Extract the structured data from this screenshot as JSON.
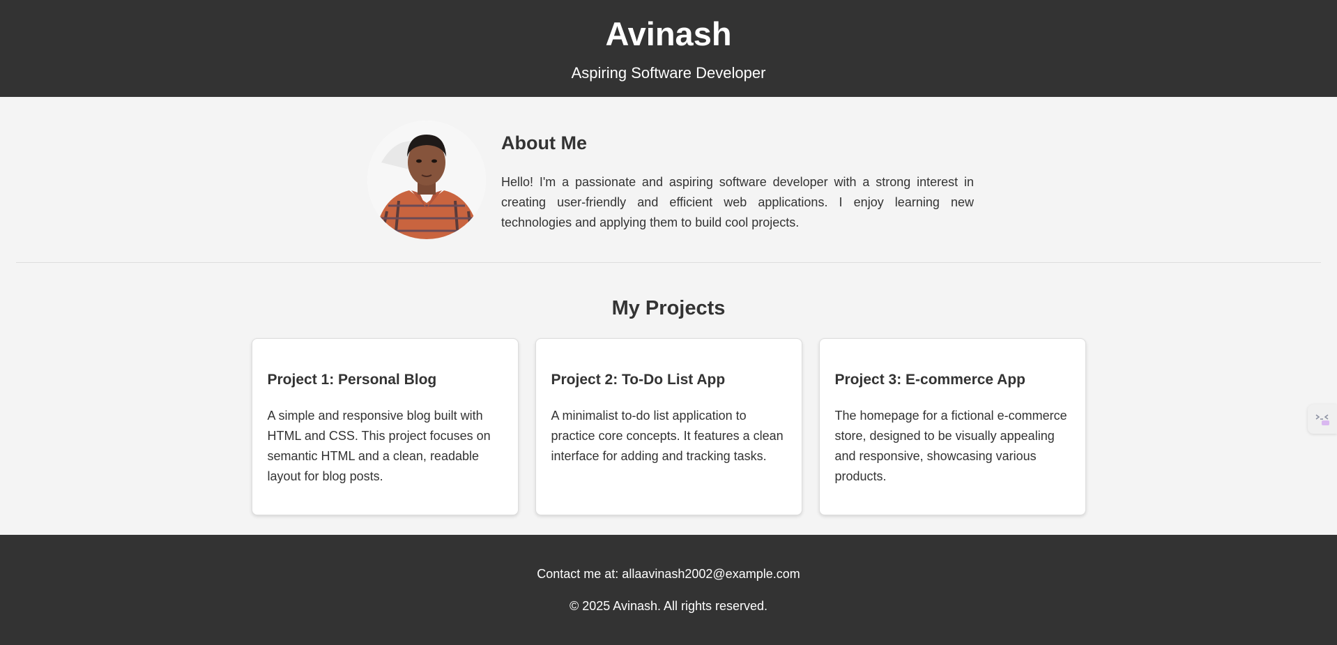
{
  "header": {
    "name": "Avinash",
    "tagline": "Aspiring Software Developer"
  },
  "about": {
    "avatar_icon": "profile-photo",
    "heading": "About Me",
    "text": "Hello! I'm a passionate and aspiring software developer with a strong interest in creating user-friendly and efficient web applications. I enjoy learning new technologies and applying them to build cool projects."
  },
  "projects": {
    "heading": "My Projects",
    "items": [
      {
        "title": "Project 1: Personal Blog",
        "description": "A simple and responsive blog built with HTML and CSS. This project focuses on semantic HTML and a clean, readable layout for blog posts."
      },
      {
        "title": "Project 2: To-Do List App",
        "description": "A minimalist to-do list application to practice core concepts. It features a clean interface for adding and tracking tasks."
      },
      {
        "title": "Project 3: E-commerce App",
        "description": "The homepage for a fictional e-commerce store, designed to be visually appealing and responsive, showcasing various products."
      }
    ]
  },
  "footer": {
    "contact": "Contact me at: allaavinash2002@example.com",
    "copyright": "© 2025 Avinash. All rights reserved."
  },
  "side_widget": {
    "icon": "assistant-icon"
  },
  "colors": {
    "header_bg": "#333333",
    "page_bg": "#f4f4f4",
    "card_bg": "#ffffff",
    "text": "#333333",
    "shirt": "#d46a45"
  }
}
